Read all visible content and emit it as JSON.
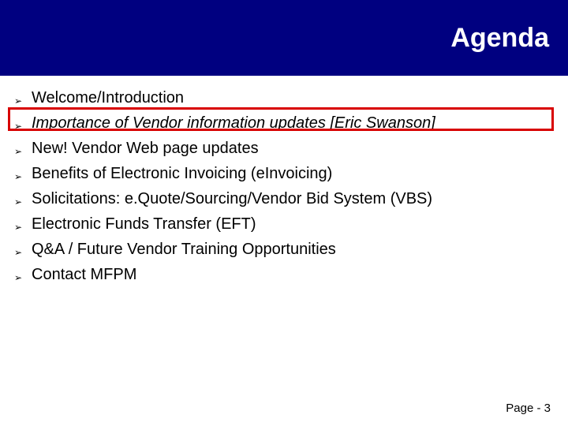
{
  "slide": {
    "title": "Agenda",
    "items": [
      {
        "text": "Welcome/Introduction",
        "emphasis": false
      },
      {
        "text": "Importance of Vendor information updates [Eric Swanson]",
        "emphasis": true
      },
      {
        "text": "New! Vendor Web page updates",
        "emphasis": false
      },
      {
        "text": "Benefits of Electronic Invoicing (eInvoicing)",
        "emphasis": false
      },
      {
        "text": "Solicitations: e.Quote/Sourcing/Vendor Bid System (VBS)",
        "emphasis": false
      },
      {
        "text": "Electronic Funds Transfer (EFT)",
        "emphasis": false
      },
      {
        "text": "Q&A / Future Vendor Training Opportunities",
        "emphasis": false
      },
      {
        "text": "Contact MFPM",
        "emphasis": false
      }
    ],
    "highlighted_index": 1,
    "bullet_glyph": "➢",
    "footer": "Page - 3"
  }
}
